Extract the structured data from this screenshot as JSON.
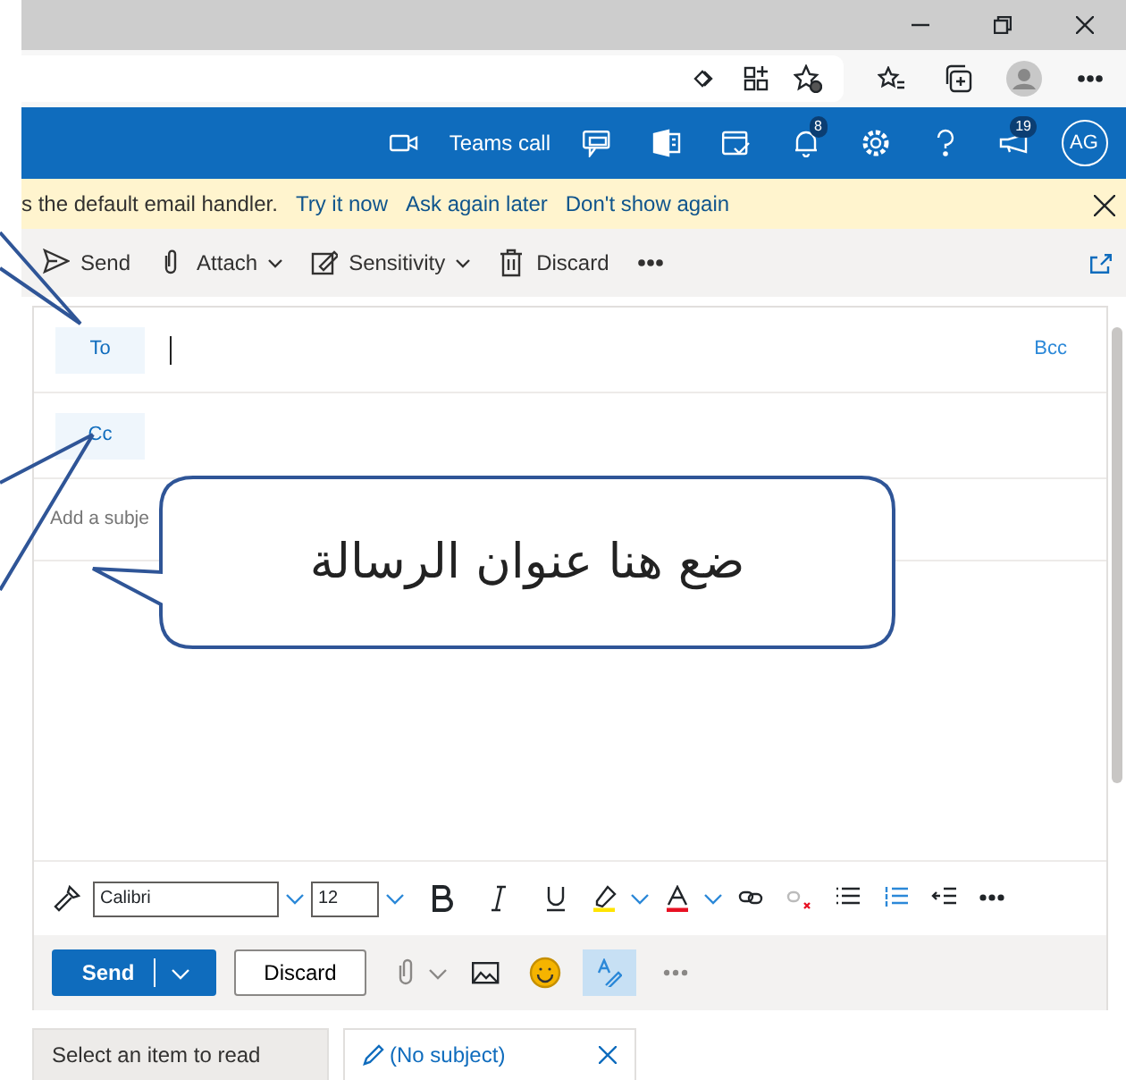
{
  "header": {
    "teams_call": "Teams call",
    "notifications_count": "8",
    "whats_new_count": "19",
    "avatar_initials": "AG"
  },
  "infobar": {
    "message": "s the default email handler.",
    "links": [
      "Try it now",
      "Ask again later",
      "Don't show again"
    ]
  },
  "command_bar": [
    {
      "kind": "send",
      "label": "Send"
    },
    {
      "kind": "attach",
      "label": "Attach",
      "dropdown": true
    },
    {
      "kind": "sensitivity",
      "label": "Sensitivity",
      "dropdown": true
    },
    {
      "kind": "discard",
      "label": "Discard"
    }
  ],
  "compose": {
    "to_label": "To",
    "bcc_label": "Bcc",
    "cc_label": "Cc",
    "subject_placeholder": "Add a subje"
  },
  "format_bar": {
    "font": "Calibri",
    "size": "12"
  },
  "actions": {
    "send": "Send",
    "discard": "Discard",
    "editor_selected": true
  },
  "callout": {
    "text": "ضع هنا عنوان الرسالة"
  },
  "bottom_tabs": [
    {
      "label": "Select an item to read",
      "selected": false,
      "kind": "reading"
    },
    {
      "label": "(No subject)",
      "selected": true,
      "kind": "draft"
    }
  ]
}
